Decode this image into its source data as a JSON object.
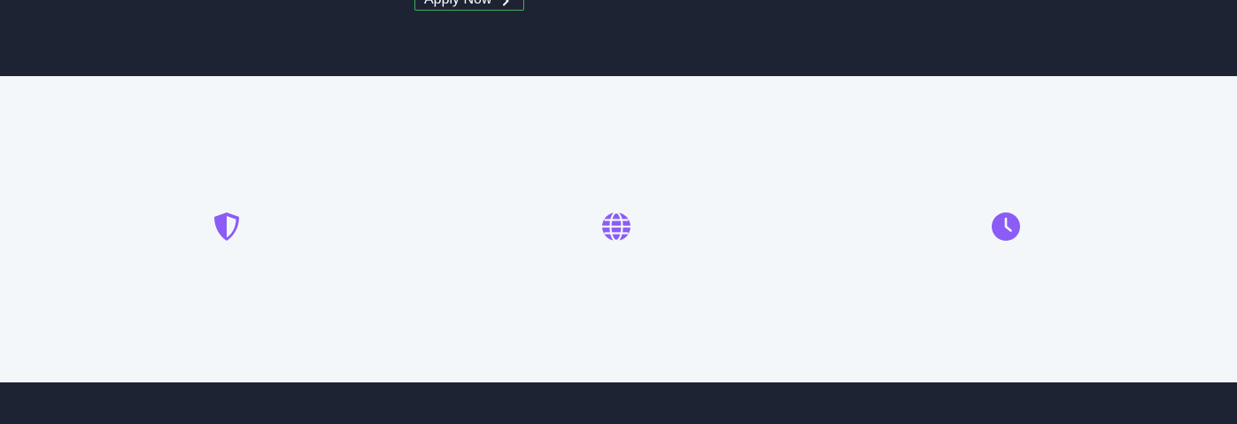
{
  "hero": {
    "apply_button_label": "Apply Now",
    "apply_button_icon": "chevron-right-icon"
  },
  "features": {
    "items": [
      {
        "icon": "shield-icon"
      },
      {
        "icon": "globe-icon"
      },
      {
        "icon": "clock-icon"
      }
    ]
  },
  "colors": {
    "dark_band": "#1e2334",
    "light_section": "#f4f7fa",
    "icon_accent": "#8b5cf6",
    "button_border": "#3fae5e"
  }
}
